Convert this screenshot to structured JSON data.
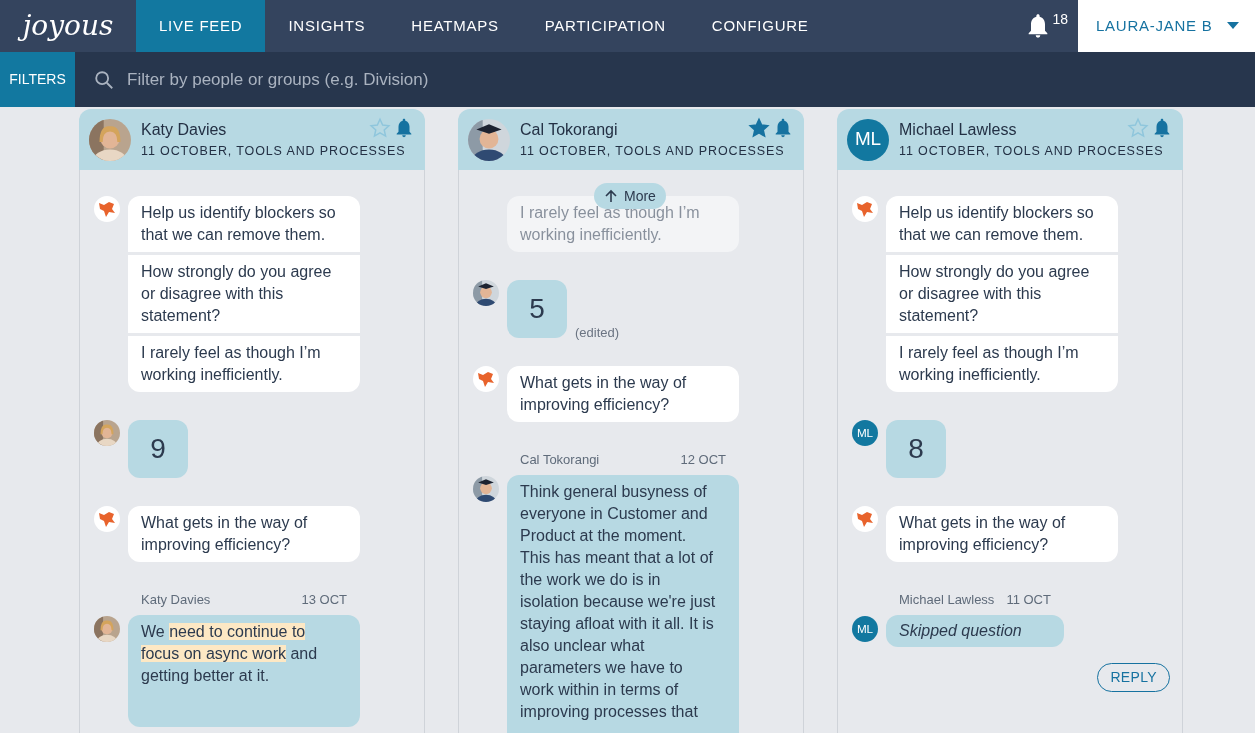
{
  "nav": {
    "logo": "joyous",
    "tabs": [
      {
        "label": "LIVE FEED",
        "selected": true
      },
      {
        "label": "INSIGHTS",
        "selected": false
      },
      {
        "label": "HEATMAPS",
        "selected": false
      },
      {
        "label": "PARTICIPATION",
        "selected": false
      },
      {
        "label": "CONFIGURE",
        "selected": false
      }
    ],
    "notifications": "18",
    "user": "LAURA-JANE B"
  },
  "filter_bar": {
    "button": "FILTERS",
    "search": {
      "placeholder": "Filter by people or groups (e.g. Division)"
    }
  },
  "columns": [
    {
      "name": "Katy Davies",
      "avatar": {
        "kind": "picture"
      },
      "subtitle": "11 OCTOBER, TOOLS AND PROCESSES",
      "starred": false,
      "messages": [
        {
          "kind": "questions",
          "faded": false,
          "parts": [
            "Help us identify blockers so that we can remove them.",
            "How strongly do you agree or disagree with this statement?",
            "I rarely feel as though I’m working inefficiently."
          ]
        },
        {
          "kind": "score",
          "avatar": {
            "kind": "picture"
          },
          "value": "9"
        },
        {
          "kind": "questions",
          "faded": false,
          "parts": [
            "What gets in the way of improving efficiency?"
          ]
        },
        {
          "kind": "answer",
          "avatar": {
            "kind": "picture"
          },
          "author": "Katy Davies",
          "date": "13 OCT",
          "segments": [
            {
              "text": "We ",
              "highlighted": false
            },
            {
              "text": "need to continue to focus on async work",
              "highlighted": true
            },
            {
              "text": " and getting better at it.",
              "highlighted": false
            }
          ]
        }
      ]
    },
    {
      "name": "Cal Tokorangi",
      "avatar": {
        "kind": "picture"
      },
      "subtitle": "11 OCTOBER, TOOLS AND PROCESSES",
      "starred": true,
      "more_button": "More",
      "messages": [
        {
          "kind": "questions",
          "faded": true,
          "parts": [
            "I rarely feel as though I’m working inefficiently."
          ]
        },
        {
          "kind": "score",
          "avatar": {
            "kind": "picture"
          },
          "value": "5",
          "note": "(edited)"
        },
        {
          "kind": "questions",
          "faded": false,
          "parts": [
            "What gets in the way of improving efficiency?"
          ]
        },
        {
          "kind": "answer",
          "avatar": {
            "kind": "picture"
          },
          "author": "Cal Tokorangi",
          "date": "12 OCT",
          "segments": [
            {
              "text": "Think general busyness of everyone in Customer and Product at the moment. This has meant that a lot of the work we do is in isolation because we're just staying afloat with it all. It is also unclear what parameters we have to work within in terms of improving processes that",
              "highlighted": false
            }
          ]
        }
      ]
    },
    {
      "name": "Michael Lawless",
      "avatar": {
        "kind": "initials",
        "initials": "ML"
      },
      "subtitle": "11 OCTOBER, TOOLS AND PROCESSES",
      "starred": false,
      "reply_button": "REPLY",
      "messages": [
        {
          "kind": "questions",
          "faded": false,
          "parts": [
            "Help us identify blockers so that we can remove them.",
            "How strongly do you agree or disagree with this statement?",
            "I rarely feel as though I’m working inefficiently."
          ]
        },
        {
          "kind": "score",
          "avatar": {
            "kind": "initials",
            "initials": "ML"
          },
          "value": "8"
        },
        {
          "kind": "questions",
          "faded": false,
          "parts": [
            "What gets in the way of improving efficiency?"
          ]
        },
        {
          "kind": "skipped",
          "avatar": {
            "kind": "initials",
            "initials": "ML"
          },
          "author": "Michael Lawless",
          "date": "11 OCT",
          "text": "Skipped question"
        }
      ]
    }
  ]
}
